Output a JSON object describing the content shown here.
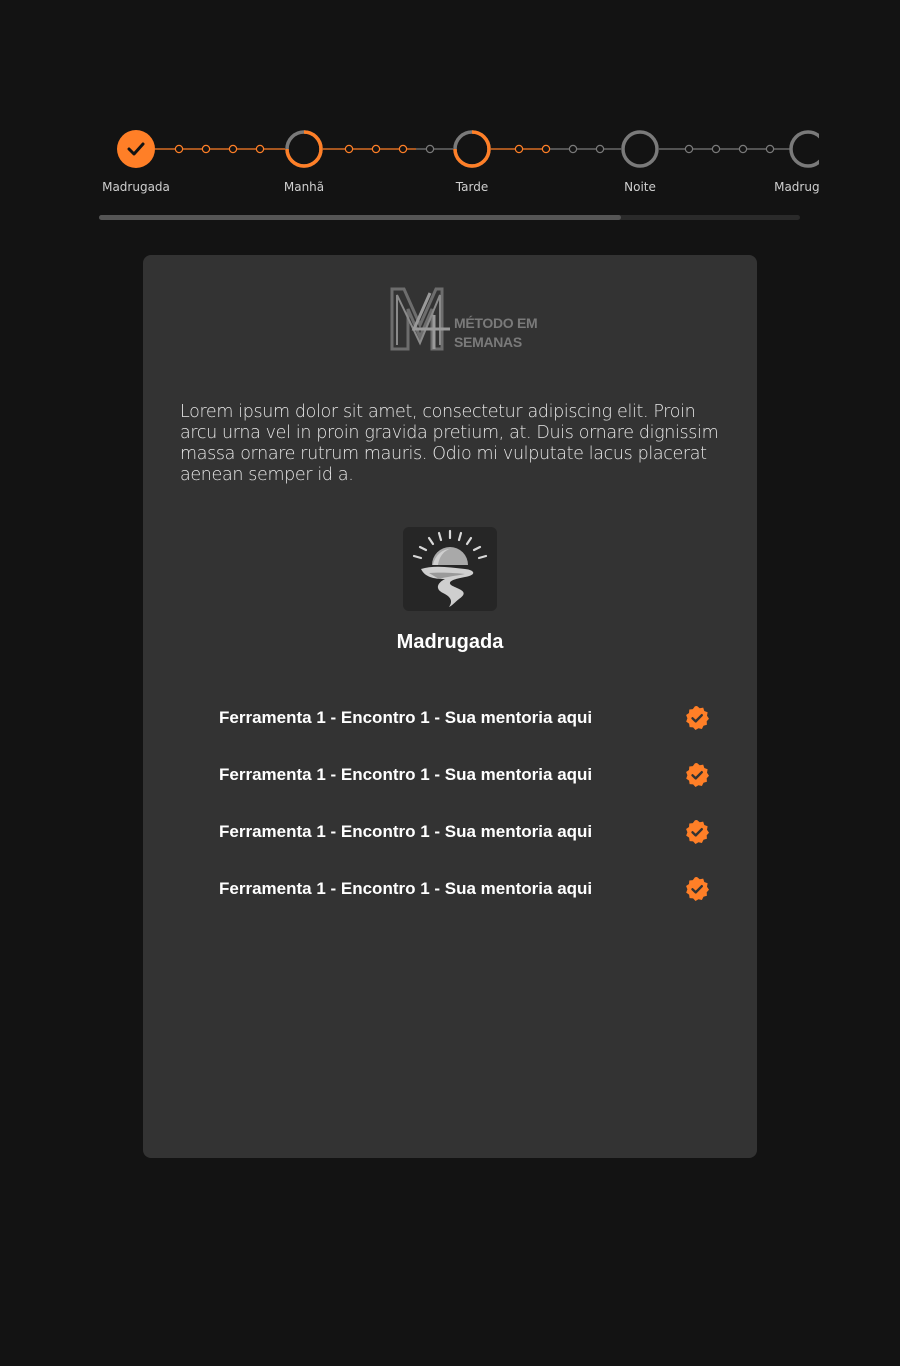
{
  "timeline": {
    "stages": [
      {
        "label": "Madrugada",
        "state": "completed"
      },
      {
        "label": "Manhã",
        "state": "in-progress"
      },
      {
        "label": "Tarde",
        "state": "in-progress"
      },
      {
        "label": "Noite",
        "state": "pending"
      },
      {
        "label": "Madrugada",
        "state": "pending"
      }
    ],
    "progress_fraction": 0.745
  },
  "card": {
    "logo_icon": "m4-logo-icon",
    "logo_line1": "MÉTODO EM",
    "logo_line2": "SEMANAS",
    "description": "Lorem ipsum dolor sit amet, consectetur adipiscing elit. Proin arcu urna vel in proin gravida pretium, at. Duis ornare dignissim massa ornare rutrum mauris. Odio mi vulputate lacus placerat aenean semper id a.",
    "period_icon": "dawn-sun-icon",
    "period_title": "Madrugada",
    "tools": [
      {
        "label": "Ferramenta 1 - Encontro 1 - Sua mentoria aqui",
        "completed": true
      },
      {
        "label": "Ferramenta 1 - Encontro 1 - Sua mentoria aqui",
        "completed": true
      },
      {
        "label": "Ferramenta 1 - Encontro 1 - Sua mentoria aqui",
        "completed": true
      },
      {
        "label": "Ferramenta 1 - Encontro 1 - Sua mentoria aqui",
        "completed": true
      }
    ]
  },
  "colors": {
    "accent": "#ff7f27",
    "background": "#131313",
    "card": "#333333",
    "pending": "#7a7a7a"
  }
}
